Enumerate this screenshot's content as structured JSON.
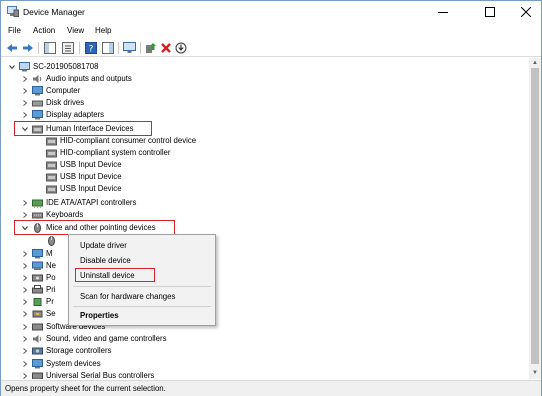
{
  "window": {
    "title": "Device Manager"
  },
  "menu": [
    "File",
    "Action",
    "View",
    "Help"
  ],
  "toolbar_icons": [
    "back-icon",
    "forward-icon",
    "show-hide-console-tree-icon",
    "properties-icon",
    "help-icon",
    "show-hide-action-pane-icon",
    "monitor-icon",
    "update-driver-icon",
    "uninstall-device-icon",
    "download-icon"
  ],
  "tree": {
    "root": "SC-201905081708",
    "items": [
      "Audio inputs and outputs",
      "Computer",
      "Disk drives",
      "Display adapters",
      "Human Interface Devices",
      "HID-compliant consumer control device",
      "HID-compliant system controller",
      "USB Input Device",
      "USB Input Device",
      "USB Input Device",
      "IDE ATA/ATAPI controllers",
      "Keyboards",
      "Mice and other pointing devices",
      "",
      "M",
      "Ne",
      "Po",
      "Pri",
      "Pr",
      "Se",
      "Software devices",
      "Sound, video and game controllers",
      "Storage controllers",
      "System devices",
      "Universal Serial Bus controllers"
    ]
  },
  "context_menu": {
    "items": [
      "Update driver",
      "Disable device",
      "Uninstall device",
      "Scan for hardware changes",
      "Properties"
    ]
  },
  "status": "Opens property sheet for the current selection.",
  "colors": {
    "highlight": "#d8232a",
    "folder": "#5b9bd5"
  }
}
